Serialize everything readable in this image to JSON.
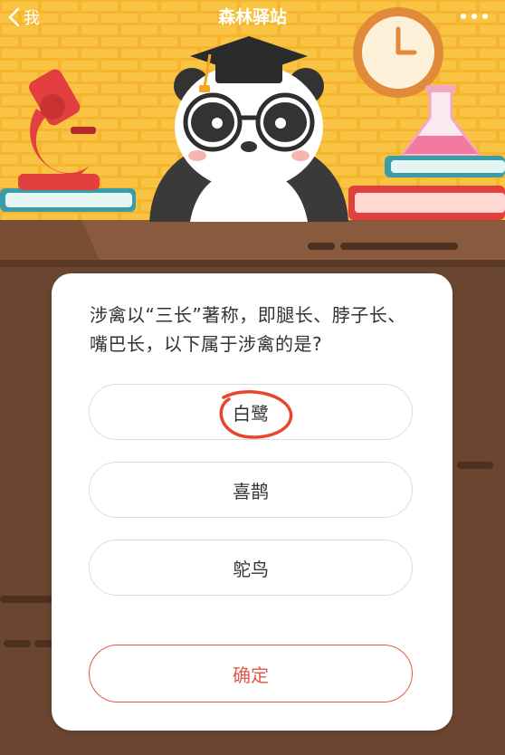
{
  "nav": {
    "back_label": "我",
    "title": "森林驿站"
  },
  "quiz": {
    "question": "涉禽以“三长”著称，即腿长、脖子长、嘴巴长，以下属于涉禽的是?",
    "options": [
      "白鹭",
      "喜鹊",
      "鸵鸟"
    ],
    "confirm_label": "确定",
    "circled_option": "白鹭"
  },
  "icons": {
    "back": "chevron-left-icon",
    "more": "more-dots-icon"
  },
  "colors": {
    "background_wall": "#f5b62f",
    "desk_brown": "#6b4530",
    "accent_red": "#e2574c",
    "annotation_circle": "#e8452c"
  }
}
